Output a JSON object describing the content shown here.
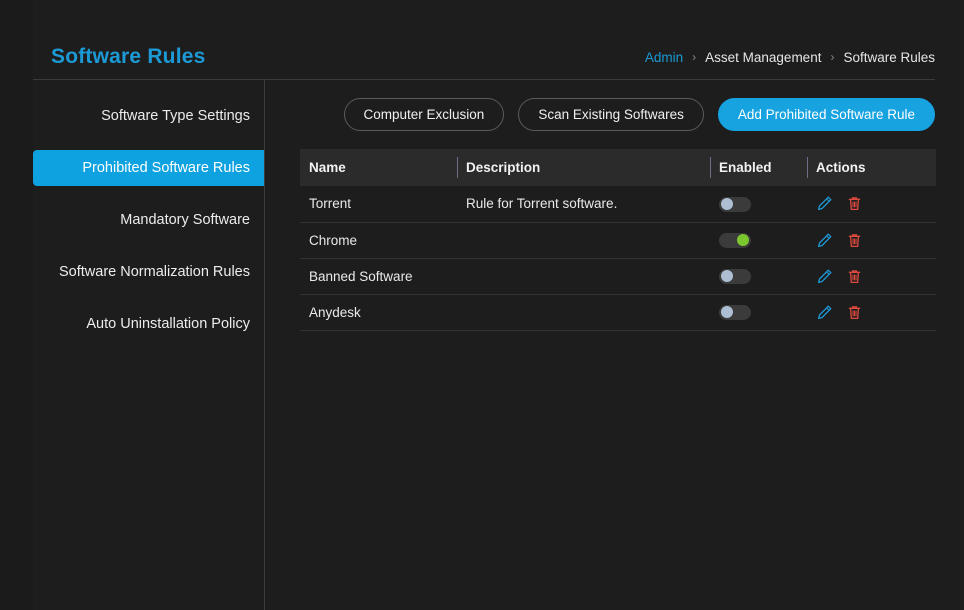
{
  "page": {
    "title": "Software Rules"
  },
  "breadcrumb": {
    "items": [
      {
        "label": "Admin",
        "type": "link"
      },
      {
        "label": "Asset Management",
        "type": "text"
      },
      {
        "label": "Software Rules",
        "type": "text"
      }
    ],
    "separator": "›"
  },
  "sidebar": {
    "items": [
      {
        "label": "Software Type Settings",
        "active": false
      },
      {
        "label": "Prohibited Software Rules",
        "active": true
      },
      {
        "label": "Mandatory Software",
        "active": false
      },
      {
        "label": "Software Normalization Rules",
        "active": false
      },
      {
        "label": "Auto Uninstallation Policy",
        "active": false
      }
    ]
  },
  "toolbar": {
    "buttons": [
      {
        "label": "Computer Exclusion",
        "style": "outline"
      },
      {
        "label": "Scan Existing Softwares",
        "style": "outline"
      },
      {
        "label": "Add Prohibited Software Rule",
        "style": "primary"
      }
    ]
  },
  "table": {
    "columns": [
      "Name",
      "Description",
      "Enabled",
      "Actions"
    ],
    "rows": [
      {
        "name": "Torrent",
        "description": "Rule for Torrent software.",
        "enabled": false,
        "actions": [
          "edit-icon",
          "delete-icon"
        ]
      },
      {
        "name": "Chrome",
        "description": "",
        "enabled": true,
        "actions": [
          "edit-icon",
          "delete-icon"
        ]
      },
      {
        "name": "Banned Software",
        "description": "",
        "enabled": false,
        "actions": [
          "edit-icon",
          "delete-icon"
        ]
      },
      {
        "name": "Anydesk",
        "description": "",
        "enabled": false,
        "actions": [
          "edit-icon",
          "delete-icon"
        ]
      }
    ]
  },
  "colors": {
    "accent": "#17a2e0",
    "accent_title": "#1c9ad6",
    "toggle_on": "#7ac82e",
    "toggle_off_knob": "#aebfd4",
    "edit_icon": "#1c9ad6",
    "delete_icon": "#e04a3f",
    "page_background": "#1d1d1d",
    "outer_background": "#1b1b1b",
    "table_header_background": "#2b2b2b"
  }
}
